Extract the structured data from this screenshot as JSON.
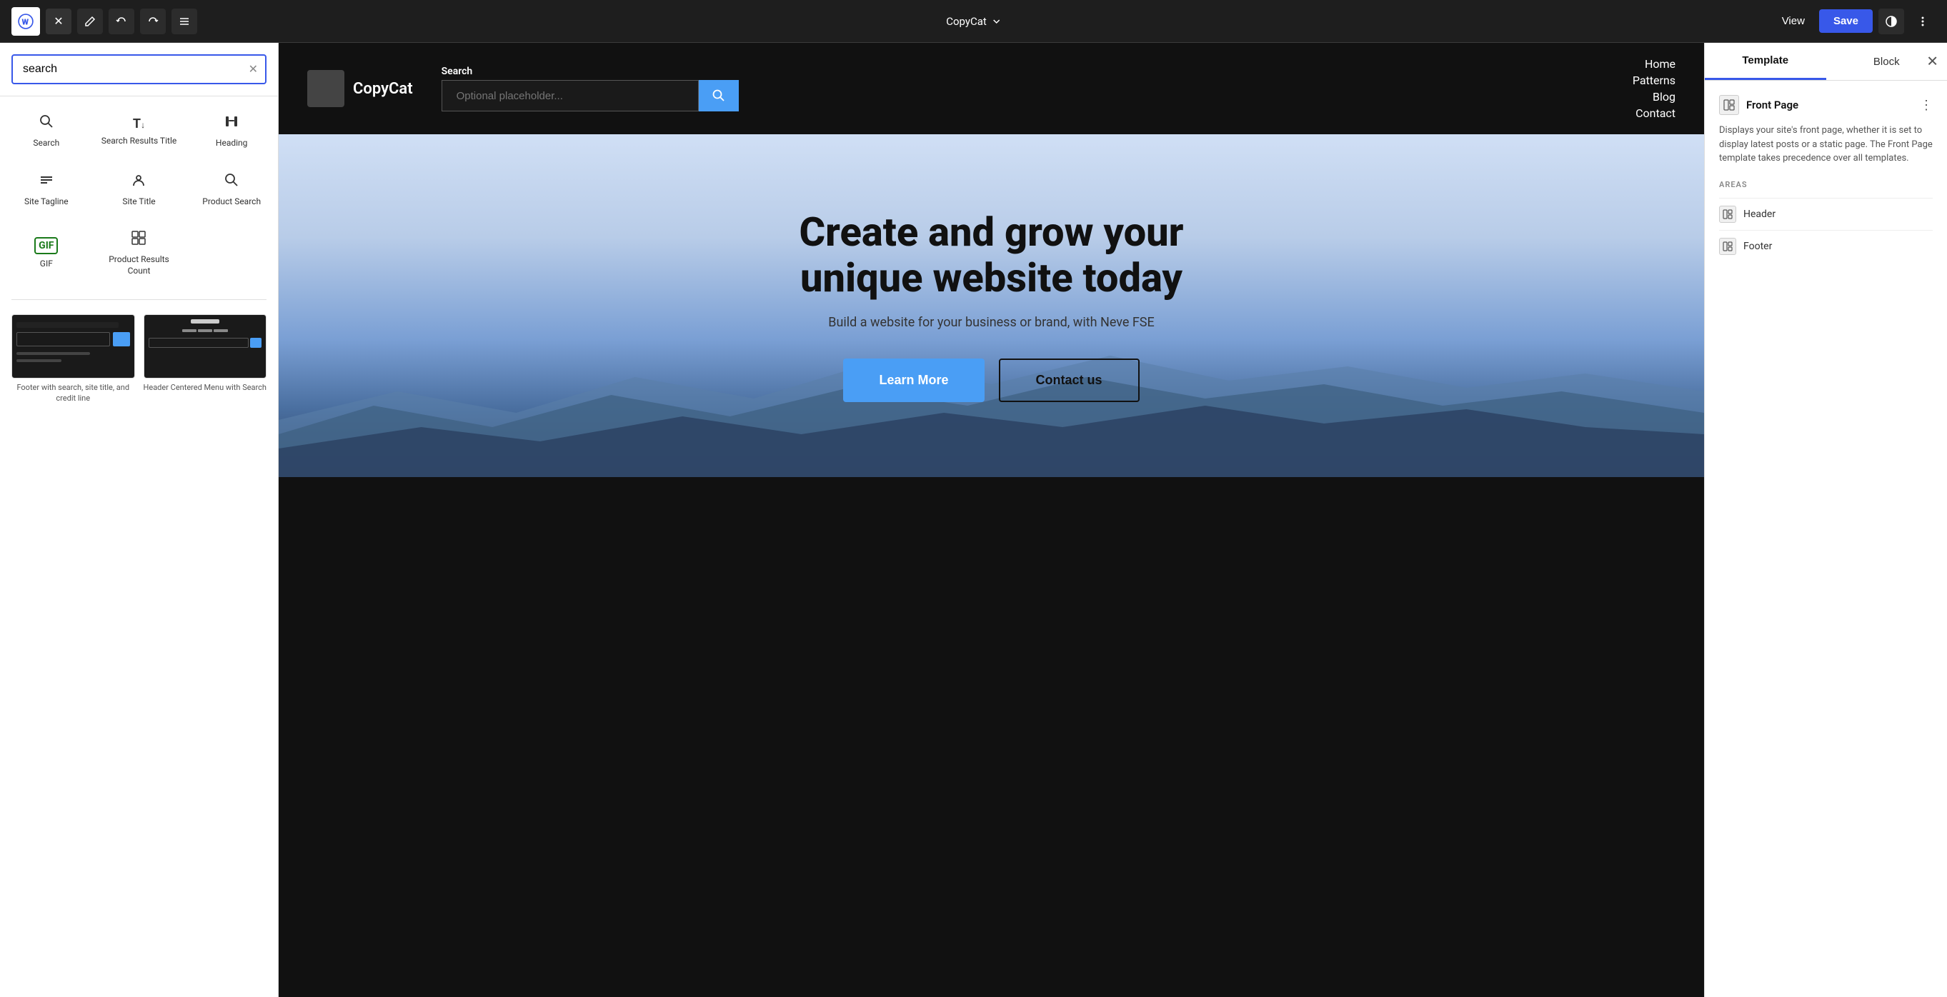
{
  "topbar": {
    "wp_logo": "W",
    "close_label": "✕",
    "pen_icon": "✏",
    "undo_icon": "↺",
    "redo_icon": "↻",
    "list_icon": "≡",
    "page_title": "Front Page",
    "chevron_down": "▾",
    "view_label": "View",
    "save_label": "Save",
    "contrast_icon": "◑",
    "more_icon": "⋮"
  },
  "left_sidebar": {
    "search_placeholder": "search",
    "search_value": "search",
    "clear_icon": "✕",
    "blocks": [
      {
        "id": "search",
        "icon": "🔍",
        "label": "Search",
        "type": "unicode"
      },
      {
        "id": "search-results-title",
        "icon": "T",
        "label": "Search Results Title",
        "type": "text"
      },
      {
        "id": "heading",
        "icon": "🔖",
        "label": "Heading",
        "type": "unicode"
      },
      {
        "id": "site-tagline",
        "icon": "≡",
        "label": "Site Tagline",
        "type": "unicode"
      },
      {
        "id": "site-title",
        "icon": "📍",
        "label": "Site Title",
        "type": "unicode"
      },
      {
        "id": "product-search",
        "icon": "🔍",
        "label": "Product Search",
        "type": "unicode"
      },
      {
        "id": "gif",
        "icon": "GIF",
        "label": "GIF",
        "type": "gif"
      },
      {
        "id": "product-results-count",
        "icon": "▦",
        "label": "Product Results Count",
        "type": "unicode"
      }
    ],
    "patterns": [
      {
        "id": "footer-search",
        "label": "Footer with search, site title, and credit line"
      },
      {
        "id": "header-centered",
        "label": "Header Centered Menu with Search"
      }
    ]
  },
  "canvas": {
    "nav": {
      "logo_placeholder": "",
      "logo_name": "CopyCat",
      "search_label": "Search",
      "search_placeholder": "Optional placeholder...",
      "search_icon": "🔍",
      "nav_links": [
        "Home",
        "Patterns",
        "Blog",
        "Contact"
      ]
    },
    "hero": {
      "title": "Create and grow your unique website today",
      "subtitle": "Build a website for your business or brand, with Neve FSE",
      "btn_primary": "Learn More",
      "btn_secondary": "Contact us"
    }
  },
  "right_sidebar": {
    "tabs": [
      "Template",
      "Block"
    ],
    "close_icon": "✕",
    "template": {
      "icon": "▦",
      "name": "Front Page",
      "more_icon": "⋮",
      "description": "Displays your site's front page, whether it is set to display latest posts or a static page. The Front Page template takes precedence over all templates.",
      "areas_label": "AREAS",
      "areas": [
        {
          "id": "header",
          "icon": "▦",
          "label": "Header"
        },
        {
          "id": "footer",
          "icon": "▦",
          "label": "Footer"
        }
      ]
    }
  }
}
